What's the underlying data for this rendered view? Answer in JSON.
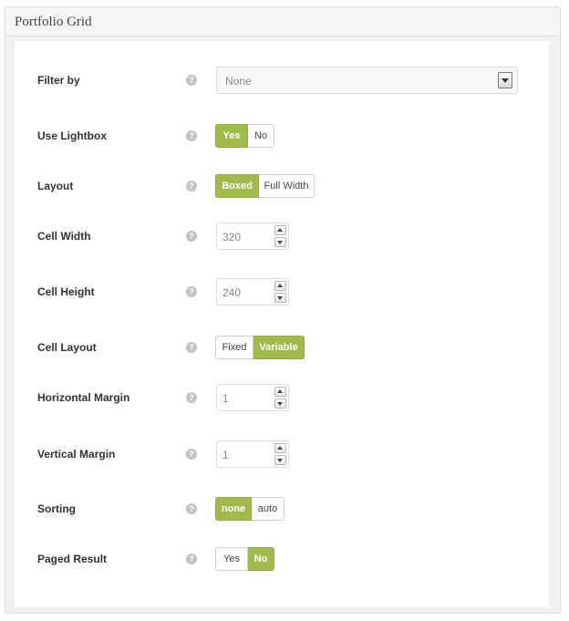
{
  "panel": {
    "title": "Portfolio Grid"
  },
  "help_glyph": "?",
  "colors": {
    "accent": "#a0bb4c",
    "help_icon": "#c3c3c3"
  },
  "fields": {
    "filter_by": {
      "label": "Filter by",
      "value": "None"
    },
    "use_lightbox": {
      "label": "Use Lightbox",
      "options": [
        "Yes",
        "No"
      ],
      "selected": "Yes"
    },
    "layout": {
      "label": "Layout",
      "options": [
        "Boxed",
        "Full Width"
      ],
      "selected": "Boxed"
    },
    "cell_width": {
      "label": "Cell Width",
      "value": "320"
    },
    "cell_height": {
      "label": "Cell Height",
      "value": "240"
    },
    "cell_layout": {
      "label": "Cell Layout",
      "options": [
        "Fixed",
        "Variable"
      ],
      "selected": "Variable"
    },
    "horizontal_margin": {
      "label": "Horizontal Margin",
      "value": "1"
    },
    "vertical_margin": {
      "label": "Vertical Margin",
      "value": "1"
    },
    "sorting": {
      "label": "Sorting",
      "options": [
        "none",
        "auto"
      ],
      "selected": "none"
    },
    "paged_result": {
      "label": "Paged Result",
      "options": [
        "Yes",
        "No"
      ],
      "selected": "No"
    }
  }
}
